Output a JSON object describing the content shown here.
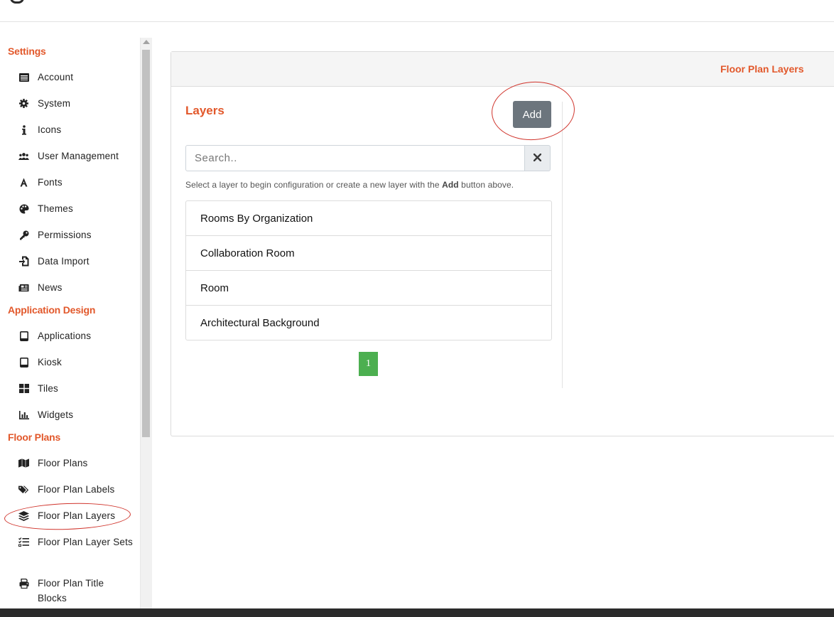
{
  "sidebar": {
    "sections": [
      {
        "title": "Settings"
      },
      {
        "title": "Application Design"
      },
      {
        "title": "Floor Plans"
      }
    ],
    "items": [
      {
        "label": "Account",
        "icon": "id-card-icon"
      },
      {
        "label": "System",
        "icon": "gear-icon"
      },
      {
        "label": "Icons",
        "icon": "info-icon"
      },
      {
        "label": "User Management",
        "icon": "users-icon"
      },
      {
        "label": "Fonts",
        "icon": "font-icon"
      },
      {
        "label": "Themes",
        "icon": "palette-icon"
      },
      {
        "label": "Permissions",
        "icon": "key-icon"
      },
      {
        "label": "Data Import",
        "icon": "file-import-icon"
      },
      {
        "label": "News",
        "icon": "newspaper-icon"
      },
      {
        "label": "Applications",
        "icon": "tablet-icon"
      },
      {
        "label": "Kiosk",
        "icon": "tablet-icon"
      },
      {
        "label": "Tiles",
        "icon": "th-large-icon"
      },
      {
        "label": "Widgets",
        "icon": "chart-bar-icon"
      },
      {
        "label": "Floor Plans",
        "icon": "map-icon"
      },
      {
        "label": "Floor Plan Labels",
        "icon": "tags-icon"
      },
      {
        "label": "Floor Plan Layers",
        "icon": "layer-group-icon"
      },
      {
        "label": "Floor Plan Layer Sets",
        "icon": "tasks-icon"
      },
      {
        "label": "Floor Plan Title Blocks",
        "icon": "print-icon"
      }
    ]
  },
  "panel": {
    "header_title": "Floor Plan Layers",
    "layers_title": "Layers",
    "add_label": "Add",
    "search_placeholder": "Search..",
    "help_prefix": "Select a layer to begin configuration or create a new layer with the ",
    "help_bold": "Add",
    "help_suffix": " button above.",
    "layers": [
      "Rooms By Organization",
      "Collaboration Room",
      "Room",
      "Architectural Background"
    ],
    "page": "1"
  },
  "colors": {
    "accent": "#e2582b",
    "button": "#6c757d",
    "pagination": "#4caf50",
    "annotation": "#d0342c"
  }
}
